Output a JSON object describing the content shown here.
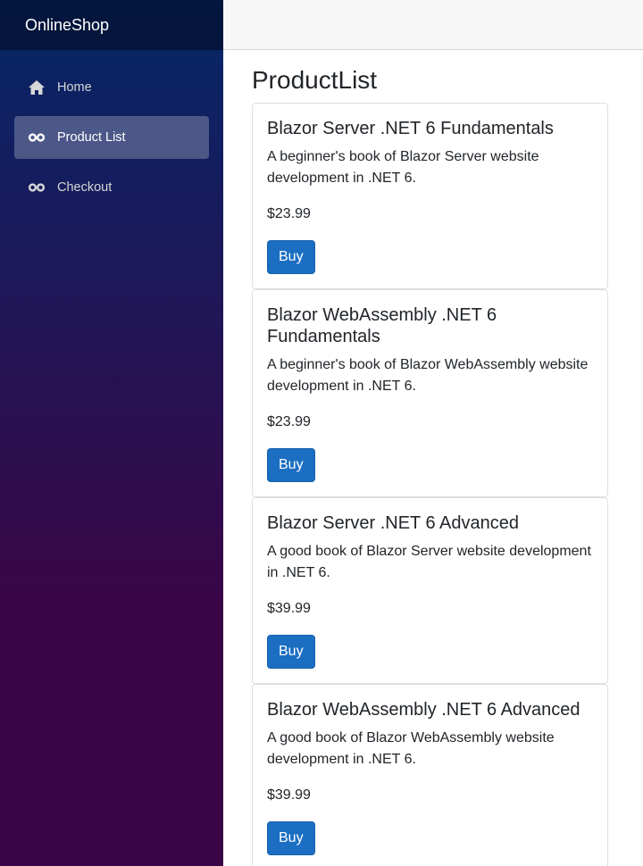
{
  "sidebar": {
    "brand": "OnlineShop",
    "items": [
      {
        "label": "Home",
        "icon": "home-icon",
        "active": false
      },
      {
        "label": "Product List",
        "icon": "infinity-icon",
        "active": true
      },
      {
        "label": "Checkout",
        "icon": "infinity-icon",
        "active": false
      }
    ]
  },
  "main": {
    "title": "ProductList",
    "products": [
      {
        "name": "Blazor Server .NET 6 Fundamentals",
        "description": "A beginner's book of Blazor Server website development in .NET 6.",
        "price": "$23.99",
        "button": "Buy"
      },
      {
        "name": "Blazor WebAssembly .NET 6 Fundamentals",
        "description": "A beginner's book of Blazor WebAssembly website development in .NET 6.",
        "price": "$23.99",
        "button": "Buy"
      },
      {
        "name": "Blazor Server .NET 6 Advanced",
        "description": "A good book of Blazor Server website development in .NET 6.",
        "price": "$39.99",
        "button": "Buy"
      },
      {
        "name": "Blazor WebAssembly .NET 6 Advanced",
        "description": "A good book of Blazor WebAssembly website development in .NET 6.",
        "price": "$39.99",
        "button": "Buy"
      }
    ]
  },
  "colors": {
    "sidebar_top": "#052767",
    "sidebar_bottom": "#3a0647",
    "button": "#1b6ec2"
  }
}
